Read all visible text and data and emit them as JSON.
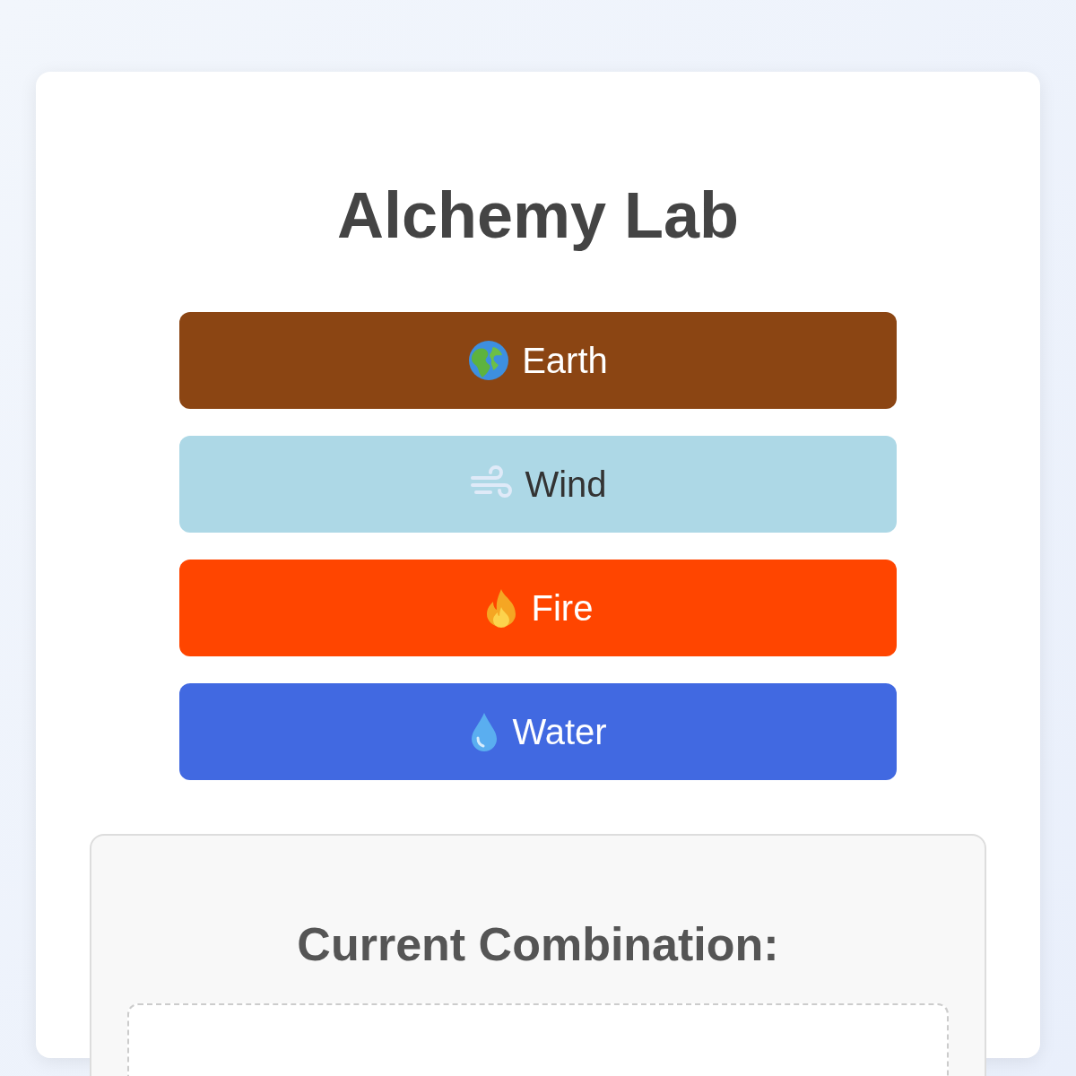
{
  "title": "Alchemy Lab",
  "elements": [
    {
      "label": "Earth",
      "kind": "earth",
      "color": "#8b4513"
    },
    {
      "label": "Wind",
      "kind": "wind",
      "color": "#add8e6"
    },
    {
      "label": "Fire",
      "kind": "fire",
      "color": "#ff4500"
    },
    {
      "label": "Water",
      "kind": "water",
      "color": "#4169e1"
    }
  ],
  "combination": {
    "heading": "Current Combination:"
  }
}
